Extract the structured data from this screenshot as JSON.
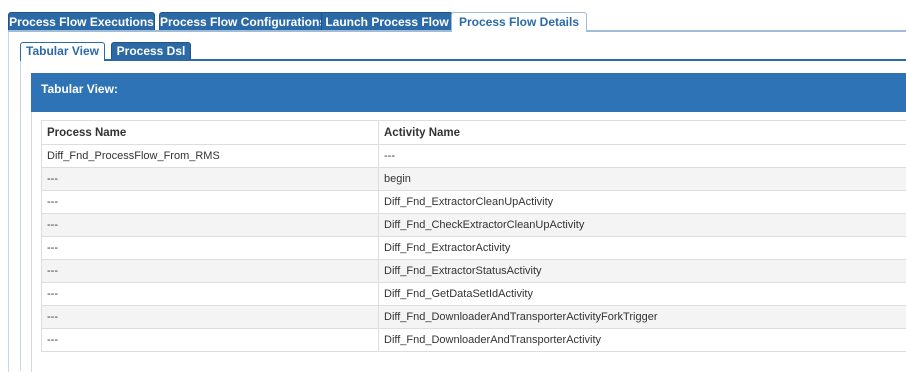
{
  "main_tabs": [
    {
      "label": "Process Flow Executions",
      "active": false
    },
    {
      "label": "Process Flow Configurations",
      "active": false
    },
    {
      "label": "Launch Process Flow",
      "active": false
    },
    {
      "label": "Process Flow Details",
      "active": true
    }
  ],
  "sub_tabs": [
    {
      "label": "Tabular View",
      "active": true
    },
    {
      "label": "Process Dsl",
      "active": false
    }
  ],
  "view_title": "Tabular View:",
  "table": {
    "columns": [
      "Process Name",
      "Activity Name"
    ],
    "rows": [
      [
        "Diff_Fnd_ProcessFlow_From_RMS",
        "---"
      ],
      [
        "---",
        "begin"
      ],
      [
        "---",
        "Diff_Fnd_ExtractorCleanUpActivity"
      ],
      [
        "---",
        "Diff_Fnd_CheckExtractorCleanUpActivity"
      ],
      [
        "---",
        "Diff_Fnd_ExtractorActivity"
      ],
      [
        "---",
        "Diff_Fnd_ExtractorStatusActivity"
      ],
      [
        "---",
        "Diff_Fnd_GetDataSetIdActivity"
      ],
      [
        "---",
        "Diff_Fnd_DownloaderAndTransporterActivityForkTrigger"
      ],
      [
        "---",
        "Diff_Fnd_DownloaderAndTransporterActivity"
      ]
    ]
  },
  "colors": {
    "tab_blue": "#2b6aa6",
    "header_blue": "#2e73b6",
    "row_alt": "#f4f4f4"
  }
}
